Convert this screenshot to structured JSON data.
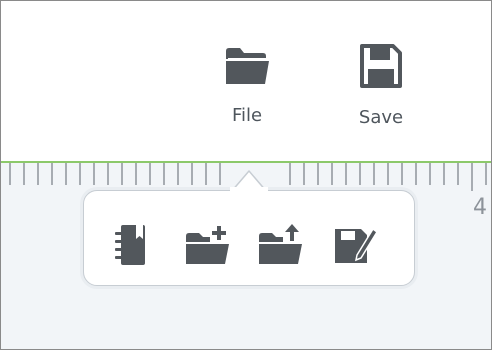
{
  "toolbar": {
    "file_label": "File",
    "save_label": "Save",
    "file_icon": "folder-icon",
    "save_icon": "floppy-disk-icon"
  },
  "ruler": {
    "visible_number": "4",
    "accent_color": "#8cc96a"
  },
  "popover": {
    "actions": [
      {
        "icon": "notebook-icon"
      },
      {
        "icon": "folder-add-icon"
      },
      {
        "icon": "folder-upload-icon"
      },
      {
        "icon": "save-as-edit-icon"
      }
    ]
  },
  "colors": {
    "icon": "#52575c",
    "label": "#4e555c",
    "ruler_background": "#f2f5f8"
  }
}
